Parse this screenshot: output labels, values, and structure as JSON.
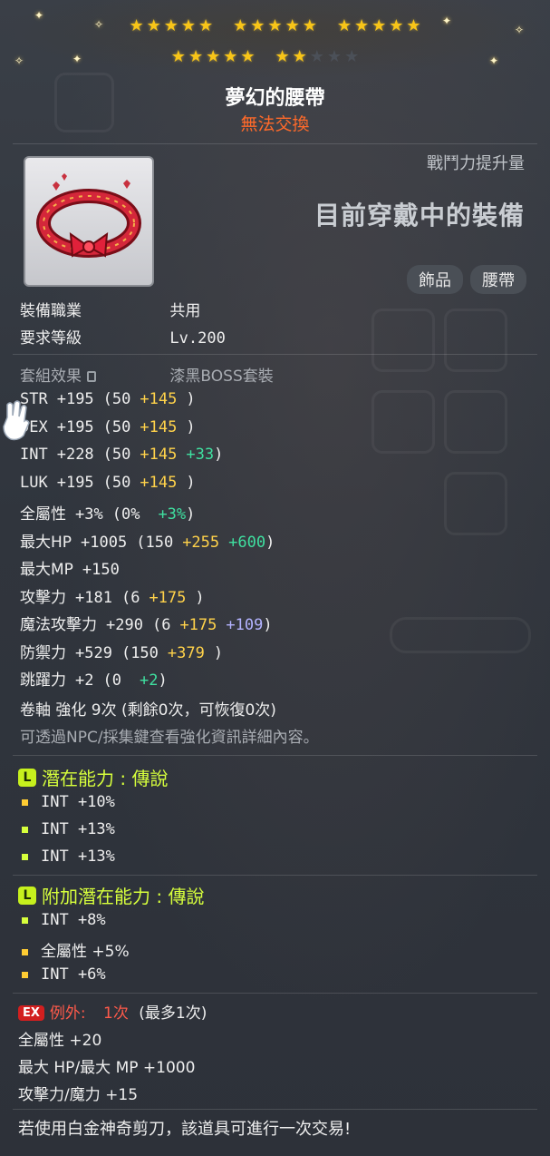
{
  "stars": {
    "filled": 22,
    "total": 25
  },
  "item": {
    "name": "夢幻的腰帶",
    "trade": "無法交換"
  },
  "power": {
    "label": "戰鬥力提升量",
    "wearing": "目前穿戴中的裝備"
  },
  "tags": [
    "飾品",
    "腰帶"
  ],
  "req": {
    "job_label": "裝備職業",
    "job_value": "共用",
    "level_label": "要求等級",
    "level_value": "Lv.200"
  },
  "set": {
    "label": "套組效果",
    "value": "漆黑BOSS套裝"
  },
  "stats": [
    {
      "name": "STR",
      "total": "+195",
      "base": "(50",
      "add1": "+145",
      "add2": "",
      "close": ")"
    },
    {
      "name": "DEX",
      "total": "+195",
      "base": "(50",
      "add1": "+145",
      "add2": "",
      "close": ")"
    },
    {
      "name": "INT",
      "total": "+228",
      "base": "(50",
      "add1": "+145",
      "add2": "+33",
      "close": ")"
    },
    {
      "name": "LUK",
      "total": "+195",
      "base": "(50",
      "add1": "+145",
      "add2": "",
      "close": ")"
    },
    {
      "name": "全屬性",
      "total": "+3%",
      "base": "(0%",
      "add1": "",
      "add2": "+3%",
      "close": ")"
    },
    {
      "name": "最大HP",
      "total": "+1005",
      "base": "(150",
      "add1": "+255",
      "add2": "+600",
      "close": ")"
    },
    {
      "name": "最大MP",
      "total": "+150",
      "base": "",
      "add1": "",
      "add2": "",
      "close": ""
    },
    {
      "name": "攻擊力",
      "total": "+181",
      "base": "(6",
      "add1": "+175",
      "add2": "",
      "close": ")"
    },
    {
      "name": "魔法攻擊力",
      "total": "+290",
      "base": "(6",
      "add1": "+175",
      "add2": "+109",
      "close": ")"
    },
    {
      "name": "防禦力",
      "total": "+529",
      "base": "(150",
      "add1": "+379",
      "add2": "",
      "close": ")"
    },
    {
      "name": "跳躍力",
      "total": "+2",
      "base": "(0",
      "add1": "",
      "add2": "+2",
      "close": ")"
    }
  ],
  "scroll": {
    "text": "卷軸 強化 9次 (剩餘0次，可恢復0次)",
    "hint": "可透過NPC/採集鍵查看強化資訊詳細內容。"
  },
  "potential": {
    "title": "潛在能力 : 傳說",
    "badge": "L",
    "lines": [
      "INT +10%",
      "INT +13%",
      "INT +13%"
    ]
  },
  "additional": {
    "title": "附加潛在能力 : 傳說",
    "badge": "L",
    "lines": [
      "INT +8%",
      "全屬性 +5%",
      "INT +6%"
    ]
  },
  "exceptional": {
    "badge": "EX",
    "label": "例外:",
    "count": "1次",
    "max": "(最多1次)",
    "lines": [
      "全屬性 +20",
      "最大 HP/最大 MP +1000",
      "攻擊力/魔力 +15"
    ]
  },
  "footer": "若使用白金神奇剪刀，該道具可進行一次交易!"
}
